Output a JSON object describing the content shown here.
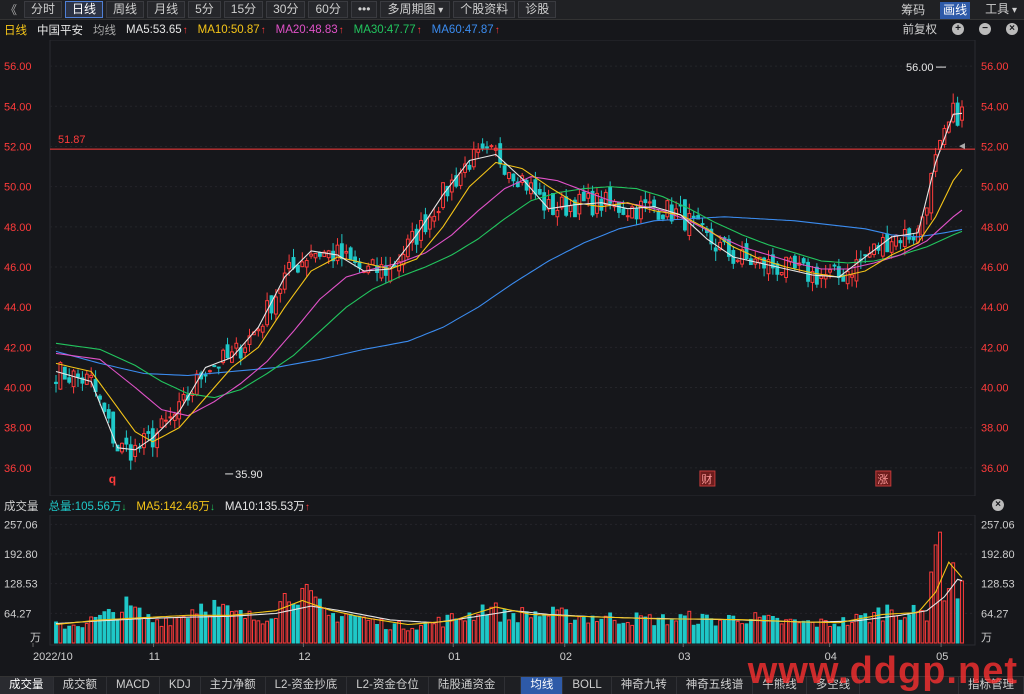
{
  "toolbar": {
    "back_icon": "double-chevron-left-icon",
    "back_glyph": "《",
    "buttons": [
      "分时",
      "日线",
      "周线",
      "月线",
      "5分",
      "15分",
      "30分",
      "60分",
      "•••",
      "多周期图",
      "个股资料",
      "诊股"
    ],
    "active_index": 1,
    "right_links": [
      "筹码",
      "画线",
      "工具"
    ],
    "right_active_index": 1
  },
  "main_header": {
    "period": "日线",
    "stock_name": "中国平安",
    "ma_label": "均线",
    "ma": [
      {
        "label": "MA5:53.65",
        "color": "#e6e6e6"
      },
      {
        "label": "MA10:50.87",
        "color": "#f5c518"
      },
      {
        "label": "MA20:48.83",
        "color": "#e052c8"
      },
      {
        "label": "MA30:47.77",
        "color": "#22c55e"
      },
      {
        "label": "MA60:47.87",
        "color": "#3b8cf0"
      }
    ],
    "fuquan": "前复权"
  },
  "volume_header": {
    "title": "成交量",
    "total": "总量:105.56万",
    "ma5": "MA5:142.46万",
    "ma10": "MA10:135.53万"
  },
  "annotations": {
    "high_label": "56.00",
    "low_label": "35.90",
    "hline_label": "51.87",
    "marker_q": "q",
    "marker_cai": "财",
    "marker_zhang": "涨"
  },
  "bottom_tabs": {
    "left": [
      "成交量",
      "成交额",
      "MACD",
      "KDJ",
      "主力净额",
      "L2-资金抄底",
      "L2-资金仓位",
      "陆股通资金"
    ],
    "left_active_index": 0,
    "right": [
      "均线",
      "BOLL",
      "神奇九转",
      "神奇五线谱",
      "牛熊线",
      "多空线"
    ],
    "right_active_index": 0,
    "manage": "指标管理"
  },
  "watermark": "www.ddgp.net",
  "colors": {
    "up": "#ff3b3b",
    "down": "#1fc8c8",
    "ma5": "#e6e6e6",
    "ma10": "#f5c518",
    "ma20": "#e052c8",
    "ma30": "#22c55e",
    "ma60": "#3b8cf0",
    "hline": "#ff3b3b"
  },
  "chart_data": [
    {
      "type": "candlestick",
      "y_ticks": [
        "56.00",
        "54.00",
        "52.00",
        "50.00",
        "48.00",
        "46.00",
        "44.00",
        "42.00",
        "40.00",
        "38.00",
        "36.00"
      ],
      "ylim": [
        35.0,
        57.0
      ],
      "x_labels": [
        "2022/10",
        "11",
        "12",
        "01",
        "02",
        "03",
        "04",
        "05"
      ],
      "hline": 51.87,
      "high": 56.0,
      "low": 35.9,
      "ma_anchors": {
        "ma5": [
          [
            0,
            40.8
          ],
          [
            8,
            40.3
          ],
          [
            14,
            37.0
          ],
          [
            18,
            36.9
          ],
          [
            22,
            37.5
          ],
          [
            28,
            38.8
          ],
          [
            34,
            41.0
          ],
          [
            40,
            41.5
          ],
          [
            46,
            43.0
          ],
          [
            52,
            45.5
          ],
          [
            58,
            46.8
          ],
          [
            64,
            46.6
          ],
          [
            70,
            45.8
          ],
          [
            76,
            45.9
          ],
          [
            82,
            47.6
          ],
          [
            88,
            49.6
          ],
          [
            94,
            51.3
          ],
          [
            100,
            51.6
          ],
          [
            106,
            50.4
          ],
          [
            112,
            48.9
          ],
          [
            118,
            49.1
          ],
          [
            124,
            49.2
          ],
          [
            130,
            48.9
          ],
          [
            136,
            49.0
          ],
          [
            142,
            48.6
          ],
          [
            148,
            47.4
          ],
          [
            154,
            46.5
          ],
          [
            160,
            46.2
          ],
          [
            166,
            45.9
          ],
          [
            172,
            45.6
          ],
          [
            178,
            45.5
          ],
          [
            184,
            46.5
          ],
          [
            190,
            47.5
          ],
          [
            196,
            47.7
          ],
          [
            200,
            51.2
          ],
          [
            204,
            53.6
          ],
          [
            206,
            53.65
          ]
        ],
        "ma10": [
          [
            0,
            41.2
          ],
          [
            8,
            40.8
          ],
          [
            14,
            39.0
          ],
          [
            18,
            37.8
          ],
          [
            22,
            37.3
          ],
          [
            28,
            38.0
          ],
          [
            34,
            39.5
          ],
          [
            40,
            41.0
          ],
          [
            46,
            42.0
          ],
          [
            52,
            44.0
          ],
          [
            58,
            45.8
          ],
          [
            64,
            46.5
          ],
          [
            70,
            46.2
          ],
          [
            76,
            45.9
          ],
          [
            82,
            46.4
          ],
          [
            88,
            48.0
          ],
          [
            94,
            50.0
          ],
          [
            100,
            51.2
          ],
          [
            106,
            50.9
          ],
          [
            112,
            50.0
          ],
          [
            118,
            49.2
          ],
          [
            124,
            49.0
          ],
          [
            130,
            49.2
          ],
          [
            136,
            48.8
          ],
          [
            142,
            48.6
          ],
          [
            148,
            47.9
          ],
          [
            154,
            47.0
          ],
          [
            160,
            46.4
          ],
          [
            166,
            46.0
          ],
          [
            172,
            45.7
          ],
          [
            178,
            45.5
          ],
          [
            184,
            45.8
          ],
          [
            190,
            46.6
          ],
          [
            196,
            47.2
          ],
          [
            200,
            48.5
          ],
          [
            204,
            50.3
          ],
          [
            206,
            50.87
          ]
        ],
        "ma20": [
          [
            0,
            41.7
          ],
          [
            10,
            41.4
          ],
          [
            18,
            40.0
          ],
          [
            24,
            38.9
          ],
          [
            30,
            38.6
          ],
          [
            36,
            39.3
          ],
          [
            42,
            40.2
          ],
          [
            48,
            41.3
          ],
          [
            54,
            42.8
          ],
          [
            60,
            44.4
          ],
          [
            66,
            45.5
          ],
          [
            72,
            45.9
          ],
          [
            78,
            46.2
          ],
          [
            84,
            46.7
          ],
          [
            90,
            47.6
          ],
          [
            96,
            48.8
          ],
          [
            102,
            49.9
          ],
          [
            108,
            50.5
          ],
          [
            114,
            50.3
          ],
          [
            120,
            49.8
          ],
          [
            126,
            49.3
          ],
          [
            132,
            49.1
          ],
          [
            138,
            48.8
          ],
          [
            144,
            48.3
          ],
          [
            150,
            47.6
          ],
          [
            156,
            47.0
          ],
          [
            162,
            46.6
          ],
          [
            168,
            46.2
          ],
          [
            174,
            45.9
          ],
          [
            180,
            45.9
          ],
          [
            186,
            46.2
          ],
          [
            192,
            46.6
          ],
          [
            198,
            47.3
          ],
          [
            204,
            48.5
          ],
          [
            206,
            48.83
          ]
        ],
        "ma30": [
          [
            0,
            42.2
          ],
          [
            10,
            41.9
          ],
          [
            18,
            41.1
          ],
          [
            24,
            40.3
          ],
          [
            30,
            39.7
          ],
          [
            36,
            39.5
          ],
          [
            42,
            39.9
          ],
          [
            48,
            40.7
          ],
          [
            54,
            41.6
          ],
          [
            60,
            42.8
          ],
          [
            66,
            44.0
          ],
          [
            72,
            44.9
          ],
          [
            78,
            45.5
          ],
          [
            84,
            46.0
          ],
          [
            90,
            46.6
          ],
          [
            96,
            47.4
          ],
          [
            102,
            48.4
          ],
          [
            108,
            49.3
          ],
          [
            114,
            49.7
          ],
          [
            120,
            49.9
          ],
          [
            126,
            50.0
          ],
          [
            132,
            49.9
          ],
          [
            138,
            49.5
          ],
          [
            144,
            48.9
          ],
          [
            150,
            48.2
          ],
          [
            156,
            47.6
          ],
          [
            162,
            47.1
          ],
          [
            168,
            46.7
          ],
          [
            174,
            46.3
          ],
          [
            180,
            46.2
          ],
          [
            186,
            46.3
          ],
          [
            192,
            46.6
          ],
          [
            198,
            47.0
          ],
          [
            204,
            47.6
          ],
          [
            206,
            47.77
          ]
        ],
        "ma60": [
          [
            0,
            41.8
          ],
          [
            10,
            41.2
          ],
          [
            20,
            40.7
          ],
          [
            30,
            40.6
          ],
          [
            40,
            40.8
          ],
          [
            50,
            41.0
          ],
          [
            60,
            41.4
          ],
          [
            70,
            41.9
          ],
          [
            80,
            42.3
          ],
          [
            88,
            43.0
          ],
          [
            96,
            44.0
          ],
          [
            104,
            45.2
          ],
          [
            112,
            46.3
          ],
          [
            120,
            47.2
          ],
          [
            128,
            47.9
          ],
          [
            136,
            48.3
          ],
          [
            144,
            48.4
          ],
          [
            152,
            48.5
          ],
          [
            160,
            48.4
          ],
          [
            168,
            48.3
          ],
          [
            176,
            48.1
          ],
          [
            184,
            47.9
          ],
          [
            190,
            47.6
          ],
          [
            196,
            47.5
          ],
          [
            202,
            47.7
          ],
          [
            206,
            47.87
          ]
        ]
      }
    },
    {
      "type": "bar",
      "y_ticks": [
        "257.06",
        "192.80",
        "128.53",
        "64.27"
      ],
      "unit_label": "万",
      "ylim": [
        0,
        260
      ],
      "volume_anchors": [
        [
          0,
          36
        ],
        [
          6,
          42
        ],
        [
          12,
          60
        ],
        [
          16,
          78
        ],
        [
          22,
          48
        ],
        [
          28,
          56
        ],
        [
          34,
          88
        ],
        [
          40,
          62
        ],
        [
          46,
          52
        ],
        [
          50,
          74
        ],
        [
          54,
          120
        ],
        [
          58,
          92
        ],
        [
          62,
          58
        ],
        [
          66,
          64
        ],
        [
          72,
          46
        ],
        [
          78,
          36
        ],
        [
          84,
          40
        ],
        [
          90,
          52
        ],
        [
          94,
          60
        ],
        [
          98,
          80
        ],
        [
          102,
          58
        ],
        [
          108,
          64
        ],
        [
          114,
          60
        ],
        [
          120,
          56
        ],
        [
          126,
          54
        ],
        [
          132,
          52
        ],
        [
          138,
          50
        ],
        [
          144,
          54
        ],
        [
          150,
          48
        ],
        [
          156,
          56
        ],
        [
          162,
          48
        ],
        [
          168,
          44
        ],
        [
          174,
          42
        ],
        [
          180,
          46
        ],
        [
          186,
          60
        ],
        [
          190,
          76
        ],
        [
          194,
          62
        ],
        [
          198,
          66
        ],
        [
          200,
          257
        ],
        [
          202,
          120
        ],
        [
          204,
          160
        ],
        [
          205,
          110
        ],
        [
          206,
          106
        ]
      ],
      "ma5_anchors": [
        [
          0,
          40
        ],
        [
          10,
          50
        ],
        [
          20,
          55
        ],
        [
          30,
          60
        ],
        [
          40,
          60
        ],
        [
          50,
          70
        ],
        [
          56,
          92
        ],
        [
          62,
          72
        ],
        [
          70,
          55
        ],
        [
          80,
          40
        ],
        [
          90,
          48
        ],
        [
          100,
          78
        ],
        [
          108,
          62
        ],
        [
          118,
          58
        ],
        [
          128,
          55
        ],
        [
          138,
          52
        ],
        [
          148,
          52
        ],
        [
          158,
          50
        ],
        [
          168,
          46
        ],
        [
          178,
          44
        ],
        [
          188,
          62
        ],
        [
          196,
          66
        ],
        [
          200,
          110
        ],
        [
          203,
          175
        ],
        [
          206,
          142
        ]
      ],
      "ma10_anchors": [
        [
          0,
          42
        ],
        [
          10,
          48
        ],
        [
          20,
          53
        ],
        [
          30,
          56
        ],
        [
          40,
          58
        ],
        [
          50,
          64
        ],
        [
          58,
          80
        ],
        [
          66,
          68
        ],
        [
          76,
          50
        ],
        [
          86,
          44
        ],
        [
          96,
          58
        ],
        [
          104,
          70
        ],
        [
          112,
          62
        ],
        [
          122,
          57
        ],
        [
          132,
          54
        ],
        [
          142,
          52
        ],
        [
          152,
          51
        ],
        [
          162,
          48
        ],
        [
          172,
          45
        ],
        [
          182,
          48
        ],
        [
          192,
          60
        ],
        [
          198,
          70
        ],
        [
          202,
          100
        ],
        [
          205,
          138
        ],
        [
          206,
          135
        ]
      ]
    }
  ]
}
